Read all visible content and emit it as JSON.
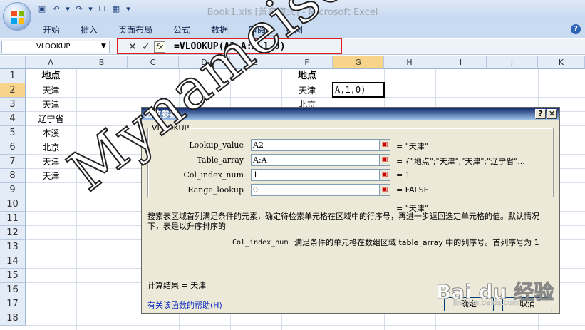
{
  "window": {
    "title": "Book1.xls  [兼容模式] - Microsoft Excel"
  },
  "ribbon": {
    "tabs": [
      "开始",
      "插入",
      "页面布局",
      "公式",
      "数据",
      "审阅",
      "视图"
    ]
  },
  "formula_bar": {
    "name_box": "VLOOKUP",
    "formula": "=VLOOKUP(A2,A:A,1,0)"
  },
  "columns": [
    "A",
    "B",
    "C",
    "D",
    "E",
    "F",
    "G",
    "H",
    "I",
    "J",
    "K"
  ],
  "rows": [
    "1",
    "2",
    "3",
    "4",
    "5",
    "6",
    "7",
    "8",
    "9",
    "10",
    "11",
    "12",
    "13",
    "14",
    "15",
    "16",
    "17",
    "18"
  ],
  "cells": {
    "A": [
      "地点",
      "天津",
      "天津",
      "辽宁省",
      "本溪",
      "北京",
      "天津",
      "天津"
    ],
    "F": [
      "地点",
      "天津",
      "北京"
    ],
    "G2": "A,1,0)"
  },
  "dialog": {
    "title": "函数参数",
    "function_name": "VLOOKUP",
    "args": [
      {
        "label": "Lookup_value",
        "value": "A2",
        "result": "= \"天津\""
      },
      {
        "label": "Table_array",
        "value": "A:A",
        "result": "= {\"地点\";\"天津\";\"天津\";\"辽宁省\"..."
      },
      {
        "label": "Col_index_num",
        "value": "1",
        "result": "= 1"
      },
      {
        "label": "Range_lookup",
        "value": "0",
        "result": "= FALSE"
      }
    ],
    "overall_result": "= \"天津\"",
    "description": "搜索表区域首列满足条件的元素，确定待检索单元格在区域中的行序号，再进一步返回选定单元格的值。默认情况下，表是以升序排序的",
    "arg_desc_name": "Col_index_num",
    "arg_desc": "满足条件的单元格在数组区域 table_array 中的列序号。首列序号为 1",
    "calc_result": "计算结果 =  天津",
    "help_link": "有关该函数的帮助(H)",
    "ok_label": "确定",
    "cancel_label": "取消"
  },
  "watermark": {
    "text": "Mynameisdahai",
    "baidu": "Bai du 经验",
    "url": "jingyan.baidu.com"
  },
  "colors": {
    "highlight_border": "#e02020",
    "dialog_title": "#0a246a",
    "header_selected": "#f8d38a"
  }
}
